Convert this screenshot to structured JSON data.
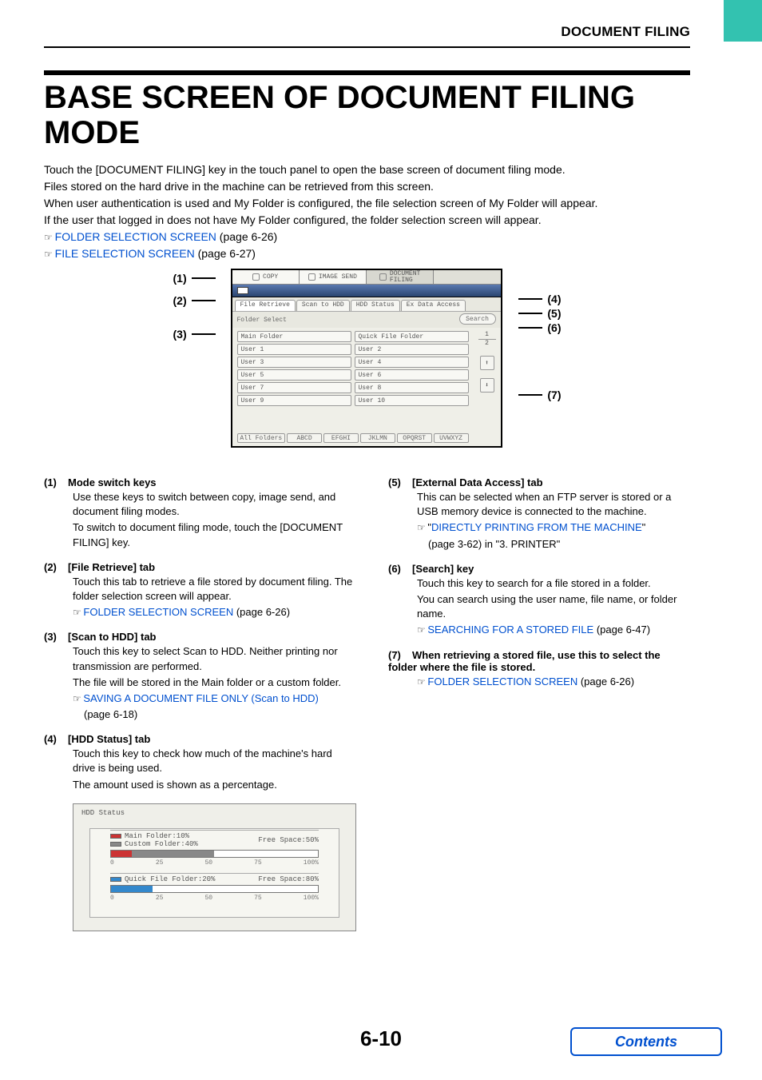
{
  "header": {
    "section": "DOCUMENT FILING"
  },
  "title": "BASE SCREEN OF DOCUMENT FILING MODE",
  "intro": {
    "p1": "Touch the [DOCUMENT FILING] key in the touch panel to open the base screen of document filing mode.",
    "p2": "Files stored on the hard drive in the machine can be retrieved from this screen.",
    "p3": "When user authentication is used and My Folder is configured, the file selection screen of My Folder will appear.",
    "p4": "If the user that logged in does not have My Folder configured, the folder selection screen will appear."
  },
  "links": {
    "folder_sel": "FOLDER SELECTION SCREEN",
    "folder_sel_pg": " (page 6-26)",
    "file_sel": "FILE SELECTION SCREEN",
    "file_sel_pg": " (page 6-27)"
  },
  "callouts": {
    "c1": "(1)",
    "c2": "(2)",
    "c3": "(3)",
    "c4": "(4)",
    "c5": "(5)",
    "c6": "(6)",
    "c7": "(7)"
  },
  "screen": {
    "mode_copy": "COPY",
    "mode_send": "IMAGE SEND",
    "mode_filing1": "DOCUMENT",
    "mode_filing2": "FILING",
    "tab_file_retrieve": "File Retrieve",
    "tab_scan_to_hdd": "Scan to HDD",
    "tab_hdd_status": "HDD Status",
    "tab_ex_data": "Ex Data Access",
    "folder_select": "Folder Select",
    "search": "Search",
    "main_folder": "Main Folder",
    "quick_file": "Quick File Folder",
    "users": [
      "User 1",
      "User 2",
      "User 3",
      "User 4",
      "User 5",
      "User 6",
      "User 7",
      "User 8",
      "User 9",
      "User 10"
    ],
    "page_top": "1",
    "page_bottom": "2",
    "arrow_up": "⬆",
    "arrow_down": "⬇",
    "alpha": [
      "All Folders",
      "ABCD",
      "EFGHI",
      "JKLMN",
      "OPQRST",
      "UVWXYZ"
    ]
  },
  "items": {
    "i1": {
      "num": "(1)",
      "head": "Mode switch keys",
      "p1": "Use these keys to switch between copy, image send, and document filing modes.",
      "p2": "To switch to document filing mode, touch the [DOCUMENT FILING] key."
    },
    "i2": {
      "num": "(2)",
      "head": "[File Retrieve] tab",
      "p1": "Touch this tab to retrieve a file stored by document filing. The folder selection screen will appear.",
      "link": "FOLDER SELECTION SCREEN",
      "link_pg": " (page 6-26)"
    },
    "i3": {
      "num": "(3)",
      "head": "[Scan to HDD] tab",
      "p1": "Touch this key to select Scan to HDD. Neither printing nor transmission are performed.",
      "p2": "The file will be stored in the Main folder or a custom folder.",
      "link": "SAVING A DOCUMENT FILE ONLY (Scan to HDD)",
      "link_pg": "(page 6-18)"
    },
    "i4": {
      "num": "(4)",
      "head": "[HDD Status] tab",
      "p1": "Touch this key to check how much of the machine's hard drive is being used.",
      "p2": "The amount used is shown as a percentage."
    },
    "i5": {
      "num": "(5)",
      "head": "[External Data Access] tab",
      "p1": "This can be selected when an FTP server is stored or a USB memory device is connected to the machine.",
      "link_q1": "\"",
      "link": "DIRECTLY PRINTING FROM THE MACHINE",
      "link_q2": "\"",
      "link_pg": "(page 3-62) in \"3. PRINTER\""
    },
    "i6": {
      "num": "(6)",
      "head": "[Search] key",
      "p1": "Touch this key to search for a file stored in a folder.",
      "p2": "You can search using the user name, file name, or folder name.",
      "link": "SEARCHING FOR A STORED FILE",
      "link_pg": " (page 6-47)"
    },
    "i7": {
      "num": "(7)",
      "head": "When retrieving a stored file, use this to select the folder where the file is stored.",
      "link": "FOLDER SELECTION SCREEN",
      "link_pg": " (page 6-26)"
    }
  },
  "hdd": {
    "title": "HDD Status",
    "main_folder": "Main Folder:10%",
    "custom_folder": "Custom Folder:40%",
    "free1": "Free Space:50%",
    "quick": "Quick File Folder:20%",
    "free2": "Free Space:80%",
    "ticks": [
      "0",
      "25",
      "50",
      "75",
      "100%"
    ]
  },
  "footer": {
    "page": "6-10",
    "contents": "Contents"
  }
}
